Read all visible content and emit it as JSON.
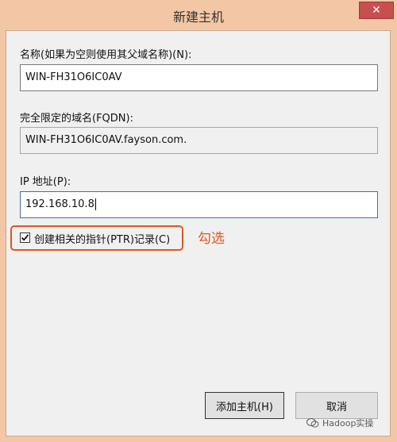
{
  "window": {
    "title": "新建主机",
    "close_glyph": "✕"
  },
  "form": {
    "name_label": "名称(如果为空则使用其父域名称)(N):",
    "name_value": "WIN-FH31O6IC0AV",
    "fqdn_label": "完全限定的域名(FQDN):",
    "fqdn_value": "WIN-FH31O6IC0AV.fayson.com.",
    "ip_label": "IP 地址(P):",
    "ip_value": "192.168.10.8",
    "ptr_checkbox_label": "创建相关的指针(PTR)记录(C)",
    "ptr_checked": true
  },
  "annotation": {
    "text": "勾选",
    "color": "#e0561e"
  },
  "buttons": {
    "add_host": "添加主机(H)",
    "cancel": "取消"
  },
  "watermark": {
    "text": "Hadoop实操",
    "icon": "wechat-icon"
  },
  "colors": {
    "frame": "#f3c7a6",
    "close_button": "#c74f4f",
    "dialog_bg": "#f0f0f0",
    "annotation": "#e0561e"
  }
}
